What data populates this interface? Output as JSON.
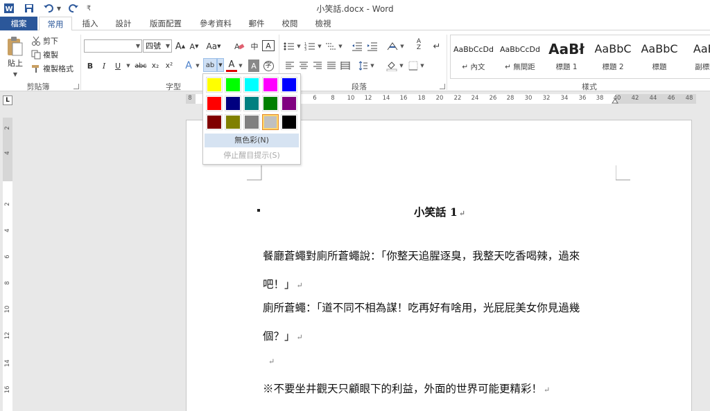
{
  "window": {
    "title": "小笑話.docx - Word"
  },
  "quick_access": {
    "customize": "₹"
  },
  "tabs": [
    {
      "id": "file",
      "label": "檔案"
    },
    {
      "id": "home",
      "label": "常用"
    },
    {
      "id": "insert",
      "label": "插入"
    },
    {
      "id": "design",
      "label": "設計"
    },
    {
      "id": "layout",
      "label": "版面配置"
    },
    {
      "id": "references",
      "label": "參考資料"
    },
    {
      "id": "mailings",
      "label": "郵件"
    },
    {
      "id": "review",
      "label": "校閱"
    },
    {
      "id": "view",
      "label": "檢視"
    }
  ],
  "clipboard": {
    "paste_label": "貼上",
    "cut_label": "剪下",
    "copy_label": "複製",
    "format_painter_label": "複製格式",
    "group_label": "剪貼簿"
  },
  "font": {
    "font_name_value": "",
    "font_size_value": "四號",
    "grow": "A",
    "shrink": "A",
    "change_case": "Aa",
    "phonetic": "中",
    "bold": "B",
    "italic": "I",
    "underline": "U",
    "strikethrough": "abc",
    "subscript": "x₂",
    "superscript": "x²",
    "text_effects": "A",
    "highlight": "ab",
    "font_color": "A",
    "char_shading": "A",
    "enclose": "字",
    "group_label": "字型"
  },
  "paragraph": {
    "group_label": "段落"
  },
  "styles": {
    "group_label": "樣式",
    "items": [
      {
        "sample": "AaBbCcDd",
        "name": "↵ 內文"
      },
      {
        "sample": "AaBbCcDd",
        "name": "↵ 無間距"
      },
      {
        "sample": "AaBł",
        "name": "標題 1"
      },
      {
        "sample": "AaBbC",
        "name": "標題 2"
      },
      {
        "sample": "AaBbC",
        "name": "標題"
      },
      {
        "sample": "AaBl",
        "name": "副標題"
      }
    ]
  },
  "ruler": {
    "h_labels": [
      "8",
      "6",
      "8",
      "10",
      "12",
      "14",
      "16",
      "18",
      "20",
      "22",
      "24",
      "26",
      "28",
      "30",
      "32",
      "34",
      "36",
      "38",
      "40",
      "42",
      "44",
      "46",
      "48"
    ],
    "v_labels": [
      "2",
      "4",
      "2",
      "4",
      "6",
      "8",
      "10",
      "12",
      "14",
      "16"
    ],
    "tab_selector": "L"
  },
  "highlight_menu": {
    "colors": [
      "#ffff00",
      "#00ff00",
      "#00ffff",
      "#ff00ff",
      "#0000ff",
      "#ff0000",
      "#000080",
      "#008080",
      "#008000",
      "#800080",
      "#800000",
      "#808000",
      "#808080",
      "#c0c0c0",
      "#000000"
    ],
    "selected_color": "#c0c0c0",
    "no_color_label": "無色彩(N)",
    "stop_label": "停止醒目提示(S)"
  },
  "document": {
    "title": "小笑話 1",
    "lines": [
      "餐廳蒼蠅對廁所蒼蠅說：「你整天追腥逐臭，我整天吃香喝辣，過來",
      "吧！」",
      "廁所蒼蠅：「道不同不相為謀！吃再好有啥用，光屁屁美女你見過幾",
      "個？」",
      "",
      "※不要坐井觀天只顧眼下的利益，外面的世界可能更精彩！"
    ],
    "paragraph_mark": "↵"
  }
}
